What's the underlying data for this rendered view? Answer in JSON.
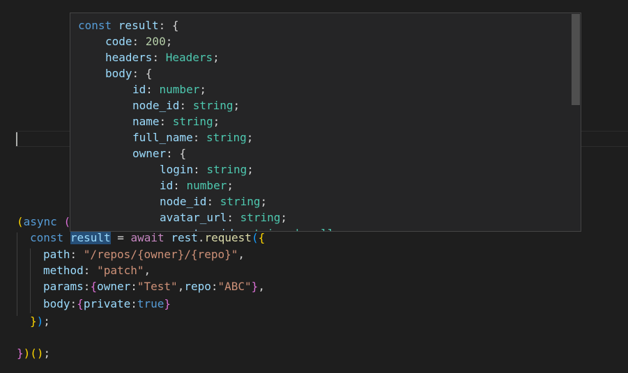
{
  "hover": {
    "lines": [
      {
        "indent": 0,
        "key": "const result",
        "sep": ": ",
        "value": "{",
        "value_kind": "punct"
      },
      {
        "indent": 1,
        "key": "code",
        "sep": ": ",
        "value": "200",
        "value_kind": "num",
        "end": ";"
      },
      {
        "indent": 1,
        "key": "headers",
        "sep": ": ",
        "value": "Headers",
        "value_kind": "type",
        "end": ";"
      },
      {
        "indent": 1,
        "key": "body",
        "sep": ": ",
        "value": "{",
        "value_kind": "punct"
      },
      {
        "indent": 2,
        "key": "id",
        "sep": ": ",
        "value": "number",
        "value_kind": "type",
        "end": ";"
      },
      {
        "indent": 2,
        "key": "node_id",
        "sep": ": ",
        "value": "string",
        "value_kind": "type",
        "end": ";"
      },
      {
        "indent": 2,
        "key": "name",
        "sep": ": ",
        "value": "string",
        "value_kind": "type",
        "end": ";"
      },
      {
        "indent": 2,
        "key": "full_name",
        "sep": ": ",
        "value": "string",
        "value_kind": "type",
        "end": ";"
      },
      {
        "indent": 2,
        "key": "owner",
        "sep": ": ",
        "value": "{",
        "value_kind": "punct"
      },
      {
        "indent": 3,
        "key": "login",
        "sep": ": ",
        "value": "string",
        "value_kind": "type",
        "end": ";"
      },
      {
        "indent": 3,
        "key": "id",
        "sep": ": ",
        "value": "number",
        "value_kind": "type",
        "end": ";"
      },
      {
        "indent": 3,
        "key": "node_id",
        "sep": ": ",
        "value": "string",
        "value_kind": "type",
        "end": ";"
      },
      {
        "indent": 3,
        "key": "avatar_url",
        "sep": ": ",
        "value": "string",
        "value_kind": "type",
        "end": ";"
      },
      {
        "indent": 3,
        "key": "gravatar_id",
        "sep": ": ",
        "value": "string | null",
        "value_kind": "type",
        "end": ";"
      }
    ]
  },
  "code": {
    "line1": {
      "paren": "(",
      "async": "async",
      "rest": " ("
    },
    "line2": {
      "const": "const",
      "result": "result",
      "eq": " = ",
      "await": "await",
      "rest": "rest",
      "dot": ".",
      "request": "request",
      "open_paren": "(",
      "open_brace": "{"
    },
    "line3": {
      "key": "path",
      "sep": ": ",
      "value": "\"/repos/{owner}/{repo}\"",
      "end": ","
    },
    "line4": {
      "key": "method",
      "sep": ": ",
      "value": "\"patch\"",
      "end": ","
    },
    "line5": {
      "key": "params",
      "sep": ":",
      "open": "{",
      "k1": "owner",
      "s1": ":",
      "v1": "\"Test\"",
      "comma": ",",
      "k2": "repo",
      "s2": ":",
      "v2": "\"ABC\"",
      "close": "}",
      "end": ","
    },
    "line6": {
      "key": "body",
      "sep": ":",
      "open": "{",
      "k1": "private",
      "s1": ":",
      "v1": "true",
      "close": "}"
    },
    "line7": {
      "close_brace": "}",
      "close_paren": ")",
      "end": ";"
    },
    "line8": {
      "close_brace": "}",
      "close_paren": ")",
      "call": "()",
      "end": ";"
    }
  }
}
